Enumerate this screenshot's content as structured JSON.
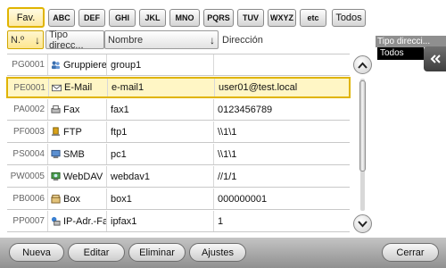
{
  "index_tabs": [
    "Fav.",
    "ABC",
    "DEF",
    "GHI",
    "JKL",
    "MNO",
    "PQRS",
    "TUV",
    "WXYZ",
    "etc",
    "Todos"
  ],
  "columns": {
    "number": "N.º",
    "type": "Tipo direcc...",
    "name": "Nombre",
    "address": "Dirección"
  },
  "rows": [
    {
      "id": "PG0001",
      "icon": "group-icon",
      "type": "Gruppieren",
      "name": "group1",
      "address": "",
      "selected": false
    },
    {
      "id": "PE0001",
      "icon": "email-icon",
      "type": "E-Mail",
      "name": "e-mail1",
      "address": "user01@test.local",
      "selected": true
    },
    {
      "id": "PA0002",
      "icon": "fax-icon",
      "type": "Fax",
      "name": "fax1",
      "address": "0123456789",
      "selected": false
    },
    {
      "id": "PF0003",
      "icon": "ftp-icon",
      "type": "FTP",
      "name": "ftp1",
      "address": "\\\\1\\1",
      "selected": false
    },
    {
      "id": "PS0004",
      "icon": "smb-icon",
      "type": "SMB",
      "name": "pc1",
      "address": "\\\\1\\1",
      "selected": false
    },
    {
      "id": "PW0005",
      "icon": "webdav-icon",
      "type": "WebDAV",
      "name": "webdav1",
      "address": "//1/1",
      "selected": false
    },
    {
      "id": "PB0006",
      "icon": "box-icon",
      "type": "Box",
      "name": "box1",
      "address": "000000001",
      "selected": false
    },
    {
      "id": "PP0007",
      "icon": "ip-fax-icon",
      "type": "IP-Adr.-Fax",
      "name": "ipfax1",
      "address": "1",
      "selected": false
    }
  ],
  "filter": {
    "label": "Tipo direcci...",
    "value": "Todos"
  },
  "actions": {
    "new": "Nueva",
    "edit": "Editar",
    "delete": "Eliminar",
    "settings": "Ajustes",
    "close": "Cerrar"
  },
  "colors": {
    "selected_border": "#e0b400",
    "selected_fill": "#fff6c5",
    "bottom_bar": "#a8a8a8"
  },
  "scrollbar": {
    "position_fraction": 0.0,
    "visible_fraction": 0.7
  }
}
